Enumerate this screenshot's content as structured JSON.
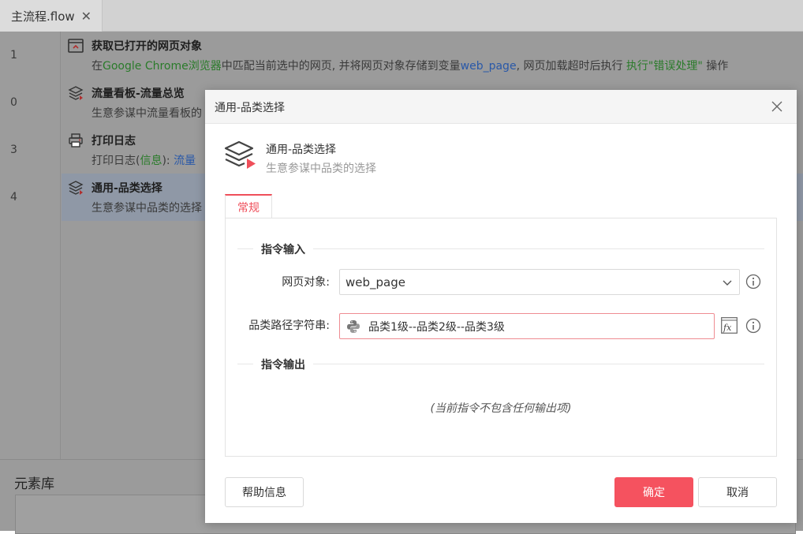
{
  "tabbar": {
    "tab_title": "主流程.flow",
    "tab_close": "✕"
  },
  "flow_rows": [
    {
      "line": "1",
      "icon": "browser-window-icon",
      "title": "获取已打开的网页对象",
      "desc_parts": [
        {
          "t": "在",
          "c": ""
        },
        {
          "t": "Google Chrome浏览器",
          "c": "g"
        },
        {
          "t": "中匹配当前选中的网页, 并将网页对象存储到变量",
          "c": ""
        },
        {
          "t": "web_page",
          "c": "b"
        },
        {
          "t": ", 网页加载超时后执行 ",
          "c": ""
        },
        {
          "t": "执行\"错误处理\"",
          "c": "g"
        },
        {
          "t": " 操作",
          "c": ""
        }
      ]
    },
    {
      "line": "0",
      "icon": "layers-icon",
      "title": "流量看板-流量总览",
      "desc_parts": [
        {
          "t": "生意参谋中流量看板的",
          "c": ""
        }
      ]
    },
    {
      "line": "3",
      "icon": "printer-icon",
      "title": "打印日志",
      "desc_parts": [
        {
          "t": "打印日志(",
          "c": ""
        },
        {
          "t": "信息",
          "c": "g"
        },
        {
          "t": "):  ",
          "c": ""
        },
        {
          "t": "流量",
          "c": "b"
        }
      ]
    },
    {
      "line": "4",
      "icon": "layers-icon",
      "title": "通用-品类选择",
      "desc_parts": [
        {
          "t": "生意参谋中品类的选择",
          "c": ""
        }
      ]
    }
  ],
  "bottom_panel": {
    "label": "元素库"
  },
  "dialog": {
    "title": "通用-品类选择",
    "command_name": "通用-品类选择",
    "command_desc": "生意参谋中品类的选择",
    "tab_general": "常规",
    "section_input": "指令输入",
    "section_output": "指令输出",
    "field_webpage_label": "网页对象:",
    "field_webpage_value": "web_page",
    "field_path_label": "品类路径字符串:",
    "field_path_value": "品类1级--品类2级--品类3级",
    "no_output_note": "(当前指令不包含任何输出项)",
    "help_button": "帮助信息",
    "ok_button": "确定",
    "cancel_button": "取消"
  },
  "colors": {
    "accent": "#f5525f",
    "variable_blue": "#2958a8",
    "keyword_green": "#2a7b2a"
  }
}
